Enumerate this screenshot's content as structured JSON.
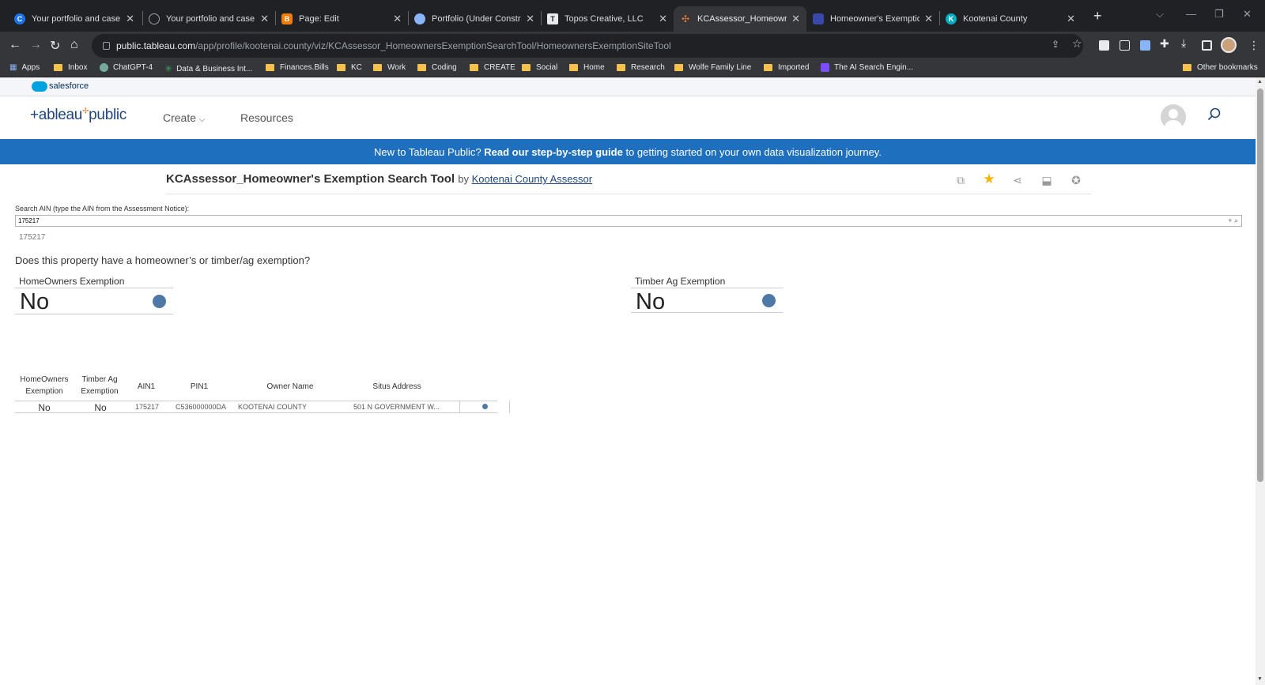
{
  "browser": {
    "tabs": [
      {
        "title": "Your portfolio and case stu",
        "fav": "C",
        "color": "#1a73e8"
      },
      {
        "title": "Your portfolio and case stu",
        "fav": "",
        "color": "#5f6368"
      },
      {
        "title": "Page: Edit",
        "fav": "",
        "color": "#f57c00"
      },
      {
        "title": "Portfolio (Under Construct",
        "fav": "",
        "color": "#5f6368"
      },
      {
        "title": "Topos Creative, LLC",
        "fav": "",
        "color": "#e8eaed"
      },
      {
        "title": "KCAssessor_Homeowner's",
        "fav": "",
        "color": "#e8762d"
      },
      {
        "title": "Homeowner's Exemption S",
        "fav": "",
        "color": "#3949ab"
      },
      {
        "title": "Kootenai County",
        "fav": "",
        "color": "#00acc1"
      }
    ],
    "url_host": "public.tableau.com",
    "url_path": "/app/profile/kootenai.county/viz/KCAssessor_HomeownersExemptionSearchTool/HomeownersExemptionSiteTool",
    "bookmarks": [
      {
        "label": "Apps",
        "kind": "apps"
      },
      {
        "label": "Inbox",
        "kind": "folder"
      },
      {
        "label": "ChatGPT-4",
        "kind": "dot",
        "color": "#74aa9c"
      },
      {
        "label": "Data & Business Int...",
        "kind": "dot",
        "color": "#34a853"
      },
      {
        "label": "Finances.Bills",
        "kind": "folder"
      },
      {
        "label": "KC",
        "kind": "folder"
      },
      {
        "label": "Work",
        "kind": "folder"
      },
      {
        "label": "Coding",
        "kind": "folder"
      },
      {
        "label": "CREATE",
        "kind": "folder"
      },
      {
        "label": "Social",
        "kind": "folder"
      },
      {
        "label": "Home",
        "kind": "folder"
      },
      {
        "label": "Research",
        "kind": "folder"
      },
      {
        "label": "Wolfe Family Line",
        "kind": "folder"
      },
      {
        "label": "Imported",
        "kind": "folder"
      },
      {
        "label": "The AI Search Engin...",
        "kind": "dot",
        "color": "#7c4dff"
      }
    ],
    "other_bookmarks": "Other bookmarks"
  },
  "salesforce": {
    "label": "salesforce"
  },
  "header": {
    "logo": "+ableau",
    "logo_suffix": "public",
    "nav": {
      "create": "Create",
      "resources": "Resources"
    }
  },
  "banner": {
    "prefix": "New to Tableau Public?",
    "bold": "Read our step-by-step guide",
    "suffix": "to getting started on your own data visualization journey."
  },
  "viz": {
    "title": "KCAssessor_Homeowner's Exemption Search Tool",
    "by": "by",
    "author": "Kootenai County Assessor"
  },
  "dashboard": {
    "search_label": "Search AIN (type the AIN from the Assessment Notice):",
    "search_value": "175217",
    "echo_value": "175217",
    "question": "Does this property have a homeowner’s or timber/ag exemption?",
    "kpis": {
      "homeowners": {
        "label": "HomeOwners Exemption",
        "value": "No"
      },
      "timber": {
        "label": "Timber Ag Exemption",
        "value": "No"
      }
    },
    "table": {
      "headers": {
        "homeowners": "HomeOwners Exemption",
        "timber": "Timber Ag Exemption",
        "ain": "AIN1",
        "pin": "PIN1",
        "owner": "Owner Name",
        "situs": "Situs Address"
      },
      "row": {
        "homeowners": "No",
        "timber": "No",
        "ain": "175217",
        "pin": "C536000000DA",
        "owner": "KOOTENAI COUNTY",
        "situs": "501 N GOVERNMENT W..."
      }
    }
  },
  "colors": {
    "banner": "#1f6fbf",
    "mark": "#4e79a7",
    "star": "#f5b400",
    "logo": "#1f457e"
  }
}
